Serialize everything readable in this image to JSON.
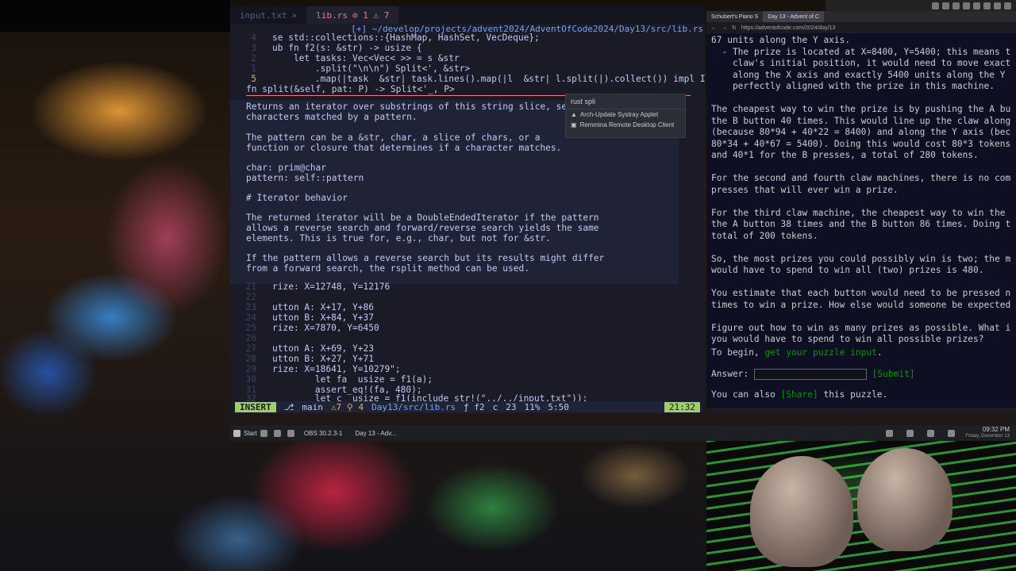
{
  "editor": {
    "tabs": [
      {
        "label": "input.txt",
        "close": "×"
      },
      {
        "label": "lib.rs",
        "diag": "⊘ 1 ⚠ 7"
      }
    ],
    "path": "[+] ~/develop/projects/advent2024/AdventOfCode2024/Day13/src/lib.rs",
    "code_top": [
      {
        "n": "4",
        "text": "se std::collections::{HashMap, HashSet, VecDeque};"
      },
      {
        "n": "3",
        "text": "ub fn f2(s: &str) -> usize {"
      },
      {
        "n": "2",
        "text": "    let tasks: Vec<Vec< >> = s &str"
      },
      {
        "n": "1",
        "text": "        .split(\"\\n\\n\") Split<', &str>"
      },
      {
        "n": "5",
        "text": "        .map(|task  &str| task.lines().map(|l  &str| l.split(|).collect()) impl Itera"
      }
    ],
    "signature": "fn split(&self, pat: P) -> Split<'_, P>",
    "doc": [
      "Returns an iterator over substrings of this string slice, separ",
      "characters matched by a pattern.",
      "",
      "The pattern can be a &str, char, a slice of chars, or a",
      "function or closure that determines if a character matches.",
      "",
      "char: prim@char",
      "pattern: self::pattern",
      "",
      "# Iterator behavior",
      "",
      "The returned iterator will be a DoubleEndedIterator if the pattern",
      "allows a reverse search and forward/reverse search yields the same",
      "elements. This is true for, e.g., char, but not for &str.",
      "",
      "If the pattern allows a reverse search but its results might differ",
      "from a forward search, the rsplit method can be used."
    ],
    "code_bottom": [
      {
        "n": "21",
        "text": "rize: X=12748, Y=12176"
      },
      {
        "n": "22",
        "text": ""
      },
      {
        "n": "23",
        "text": "utton A: X+17, Y+86"
      },
      {
        "n": "24",
        "text": "utton B: X+84, Y+37"
      },
      {
        "n": "25",
        "text": "rize: X=7870, Y=6450"
      },
      {
        "n": "26",
        "text": ""
      },
      {
        "n": "27",
        "text": "utton A: X+69, Y+23"
      },
      {
        "n": "28",
        "text": "utton B: X+27, Y+71"
      },
      {
        "n": "29",
        "text": "rize: X=18641, Y=10279\";"
      },
      {
        "n": "30",
        "text": "        let fa  usize = f1(a);"
      },
      {
        "n": "31",
        "text": "        assert_eq!(fa, 480);"
      },
      {
        "n": "32",
        "text": "        let c  usize = f1(include_str!(\"../../input.txt\"));"
      }
    ],
    "status": {
      "mode": "INSERT",
      "branch": "main",
      "diag": "⚠7 ⚲ 4",
      "file": "Day13/src/lib.rs",
      "func": "ƒ f2",
      "lang": "c",
      "count": "23",
      "percent": "11%",
      "pos": "5:50",
      "time": "21:32"
    }
  },
  "search_popup": {
    "query": "rust spli",
    "items": [
      "Arch-Update Systray Applet",
      "Remmina Remote Desktop Client"
    ]
  },
  "browser": {
    "tabs": [
      "Schubert's Piano S",
      "Day 13 - Advent of C"
    ],
    "url": "https://adventofcode.com/2024/day/13",
    "paragraphs": [
      "67 units along the Y axis.",
      "  - The prize is located at X=8400, Y=5400; this means t",
      "    claw's initial position, it would need to move exact",
      "    along the X axis and exactly 5400 units along the Y",
      "    perfectly aligned with the prize in this machine.",
      "",
      "The cheapest way to win the prize is by pushing the A bu",
      "the B button 40 times. This would line up the claw along",
      "(because 80*94 + 40*22 = 8400) and along the Y axis (bec",
      "80*34 + 40*67 = 5400). Doing this would cost 80*3 tokens",
      "and 40*1 for the B presses, a total of 280 tokens.",
      "",
      "For the second and fourth claw machines, there is no com",
      "presses that will ever win a prize.",
      "",
      "For the third claw machine, the cheapest way to win the",
      "the A button 38 times and the B button 86 times. Doing t",
      "total of 200 tokens.",
      "",
      "So, the most prizes you could possibly win is two; the m",
      "would have to spend to win all (two) prizes is 480.",
      "",
      "You estimate that each button would need to be pressed n",
      "times to win a prize. How else would someone be expected",
      "",
      "Figure out how to win as many prizes as possible. What i",
      "you would have to spend to win all possible prizes?"
    ],
    "begin_prefix": "To begin, ",
    "begin_link": "get your puzzle input",
    "begin_suffix": ".",
    "answer_label": "Answer:",
    "submit": "[Submit]",
    "share_prefix": "You can also ",
    "share_link": "[Share]",
    "share_suffix": " this puzzle."
  },
  "taskbar": {
    "start": "Start",
    "apps": [
      "OBS 30.2.3-1",
      "Day 13 - Adv..."
    ],
    "time": "09:32 PM",
    "date": "Friday, December 13"
  },
  "colors": {
    "editor_bg": "#1a1b26",
    "aoc_bg": "#0f0f23",
    "aoc_link": "#009900",
    "insert": "#9ece6a"
  }
}
